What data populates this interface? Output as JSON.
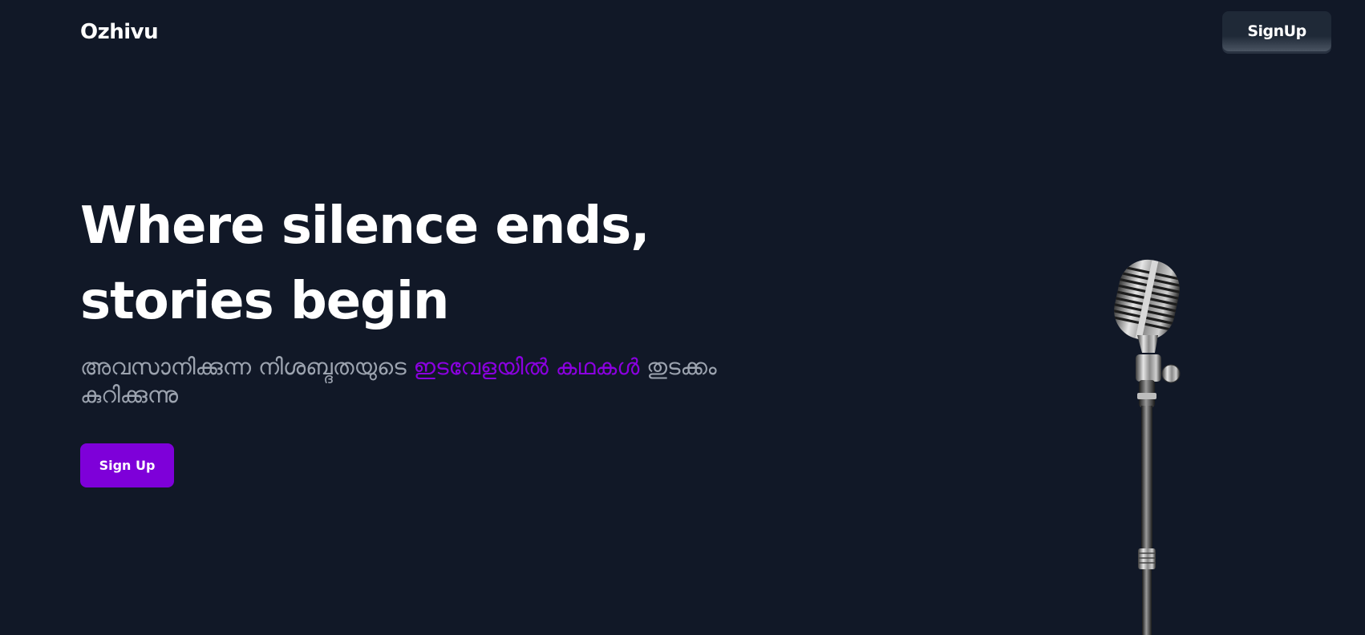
{
  "brand": {
    "name": "Ozhivu"
  },
  "nav": {
    "signup_label": "SignUp"
  },
  "hero": {
    "title_line1": "Where silence ends,",
    "title_line2": "stories begin",
    "tagline_part1": "അവസാനിക്കുന്ന നിശബ്ദതയുടെ ",
    "tagline_accent": "ഇടവേളയിൽ കഥകൾ",
    "tagline_part2": " തുടക്കം കുറിക്കുന്നു",
    "cta_label": "Sign Up"
  },
  "image": {
    "icon": "microphone-icon"
  },
  "colors": {
    "background": "#111827",
    "accent": "#7e00d9",
    "tagline": "#9ca3af"
  }
}
